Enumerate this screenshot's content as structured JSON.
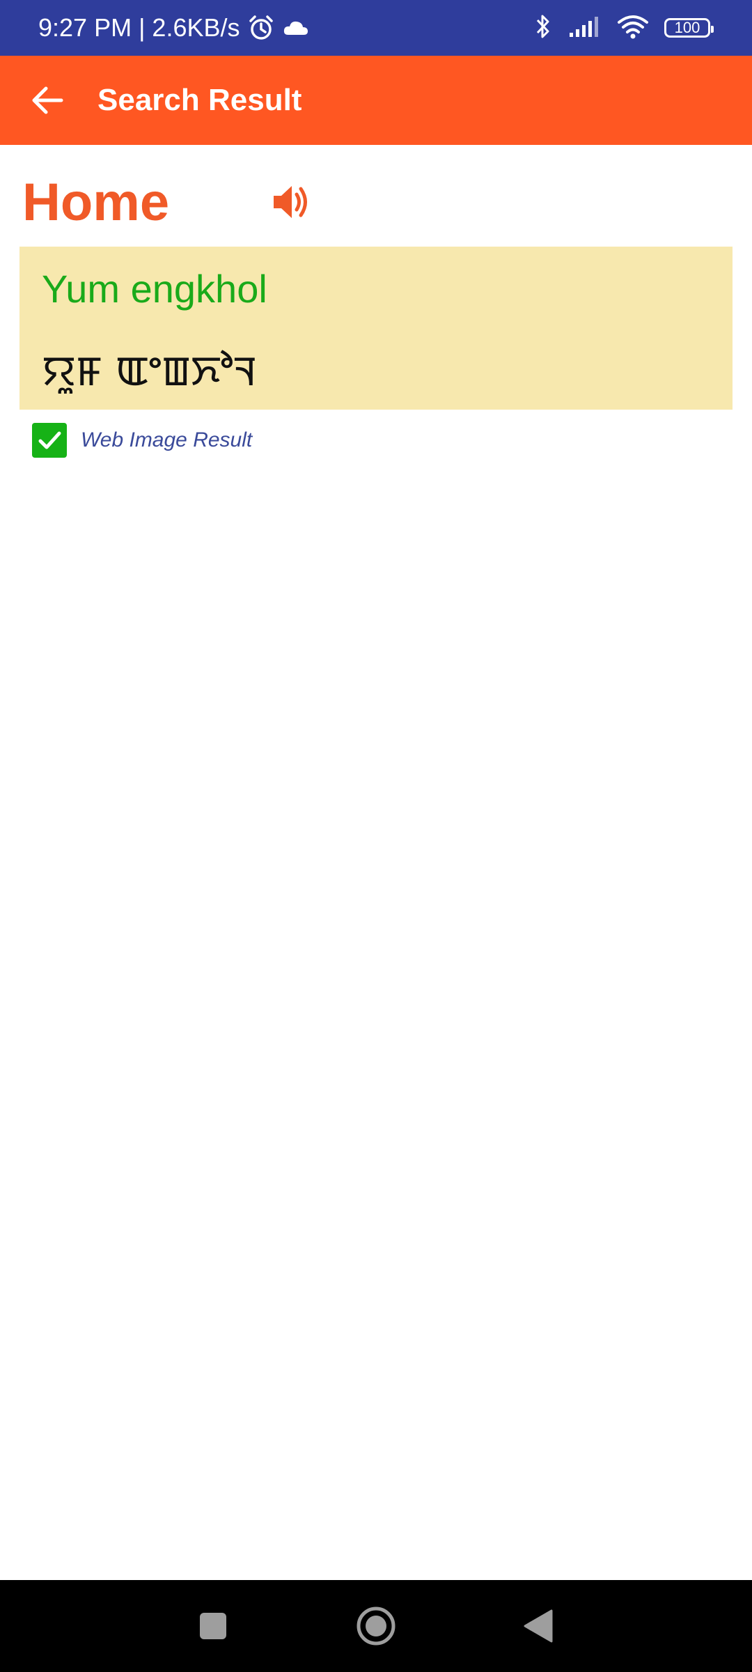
{
  "status_bar": {
    "time": "9:27 PM | 2.6KB/s",
    "battery": "100",
    "icons": [
      "alarm-icon",
      "cloud-icon",
      "bluetooth-icon",
      "signal-icon",
      "wifi-icon",
      "battery-icon"
    ]
  },
  "app_bar": {
    "title": "Search Result",
    "back_icon": "back-arrow-icon",
    "color": "#ff5722"
  },
  "word": {
    "title": "Home",
    "speaker_icon": "speaker-icon",
    "color": "#f05a28"
  },
  "result": {
    "translation": "Yum engkhol",
    "script": "ꯌꯨꯝ ꯑꯦꯡꯈꯣꯜ",
    "background": "#f7e8ae"
  },
  "web_image": {
    "label": "Web Image Result",
    "checked": true
  },
  "nav_bar": {
    "icons": [
      "recents-square-icon",
      "home-circle-icon",
      "back-triangle-icon"
    ]
  }
}
